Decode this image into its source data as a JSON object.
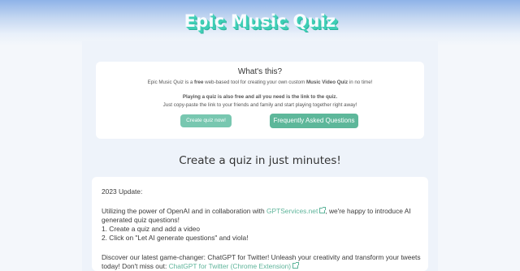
{
  "header": {
    "logo_text": "Epic Music Quiz"
  },
  "intro": {
    "title": "What's this?",
    "line1_pre": "Epic Music Quiz is a ",
    "line1_bold": "free",
    "line1_mid": " web-based tool for creating your own custom ",
    "line1_bold2": "Music Video Quiz",
    "line1_post": " in no time!",
    "line2": "Playing a quiz is also free and all you need is the link to the quiz.",
    "line3": "Just copy-paste the link to your friends and family and start playing together right away!",
    "create_button": "Create quiz now!",
    "faq_button": "Frequently Asked Questions"
  },
  "headline": "Create a quiz in just minutes!",
  "update": {
    "heading": "2023 Update:",
    "p1_pre": "Utilizing the power of OpenAI and in collaboration with ",
    "p1_link": "GPTServices.net",
    "p1_post": ", we're happy to introduce AI",
    "p1_line2": "generated quiz questions!",
    "step1": "1. Create a quiz and add a video",
    "step2": "2. Click on \"Let AI generate questions\" and viola!",
    "p2_line1": "Discover our latest game-changer: ChatGPT for Twitter! Unleash your creativity and transform your tweets",
    "p2_pre": "today! Don't miss out: ",
    "p2_link": "ChatGPT for Twitter (Chrome Extension)"
  },
  "colors": {
    "accent": "#5db79a",
    "link": "#5eb49a",
    "logo_shadow": "#3fcfb6"
  }
}
